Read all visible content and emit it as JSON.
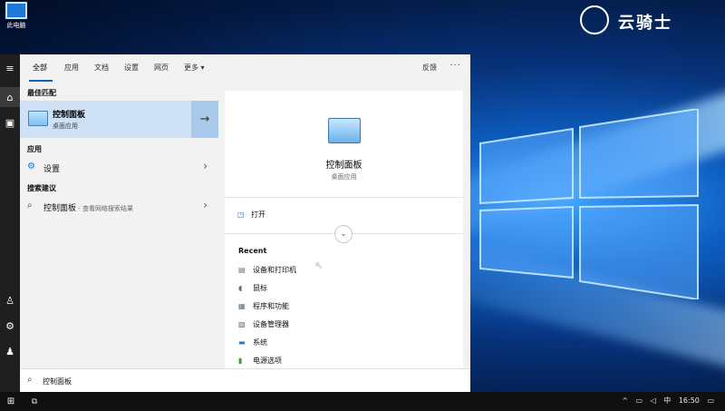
{
  "desktop": {
    "icon_label": "此电脑",
    "brand_text": "云骑士"
  },
  "tabs": {
    "items": [
      "全部",
      "应用",
      "文档",
      "设置",
      "网页",
      "更多 ▾"
    ],
    "feedback": "反馈",
    "more_menu": "···"
  },
  "results": {
    "best_match_header": "最佳匹配",
    "best_match": {
      "title": "控制面板",
      "subtitle": "桌面应用"
    },
    "apps_header": "应用",
    "app_item": "设置",
    "suggestions_header": "搜索建议",
    "suggestion": {
      "term": "控制面板",
      "hint": " - 查看网络搜索结果"
    }
  },
  "detail": {
    "title": "控制面板",
    "subtitle": "桌面应用",
    "open_label": "打开",
    "recent_header": "Recent",
    "recent_items": [
      "设备和打印机",
      "鼠标",
      "程序和功能",
      "设备管理器",
      "系统",
      "电源选项"
    ]
  },
  "search": {
    "value": "控制面板"
  },
  "taskbar": {
    "ime": "中",
    "time": "16:50"
  },
  "colors": {
    "accent": "#0a63b8",
    "best_match_bg": "#cfe1f5"
  }
}
